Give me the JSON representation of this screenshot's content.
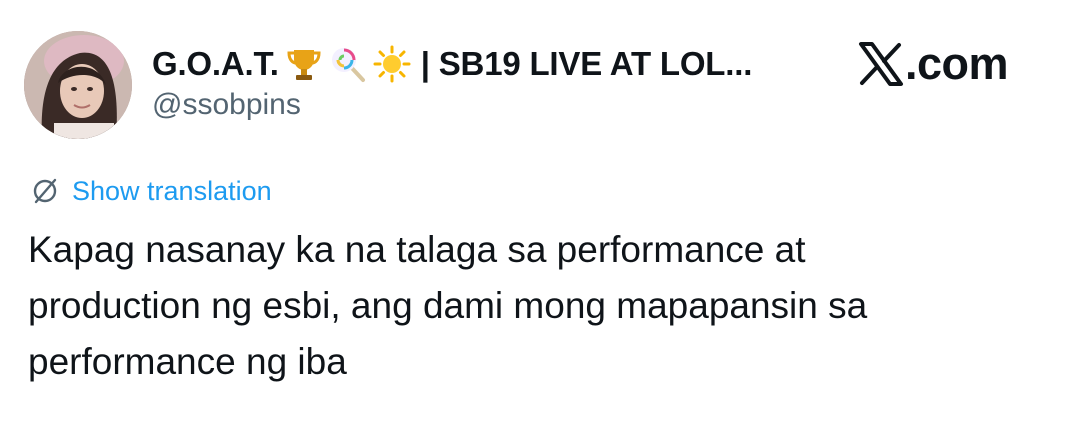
{
  "tweet": {
    "author": {
      "display_name": "G.O.A.T.",
      "emojis": [
        "trophy-icon",
        "lollipop-icon",
        "sun-icon"
      ],
      "bio_suffix": "| SB19 LIVE AT LOL...",
      "handle": "@ssobpins"
    },
    "brand_label": ".com",
    "translation_link": "Show translation",
    "text_lines": [
      "Kapag nasanay ka na talaga sa performance at",
      "production ng esbi, ang dami mong mapapansin sa",
      "performance ng iba"
    ]
  },
  "colors": {
    "link_blue": "#1d9bf0",
    "handle_gray": "#536471",
    "text_black": "#0f1419"
  }
}
